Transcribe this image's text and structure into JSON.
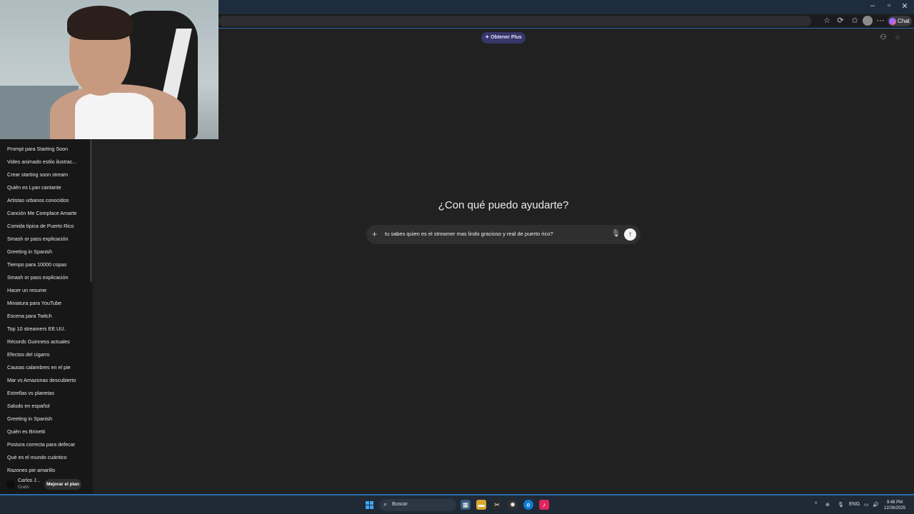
{
  "browser": {
    "chat_label": "Chat",
    "window_controls": [
      "–",
      "▫",
      "✕"
    ]
  },
  "header": {
    "plus_label": "Obtener Plus"
  },
  "sidebar": {
    "items": [
      "Prompt para Starting Soon",
      "Video animado estilo ilustrac...",
      "Crear starting soon stream",
      "Quién es Lyan cantante",
      "Artistas urbanos conocidos",
      "Canción Me Complace Amarte",
      "Comida típica de Puerto Rico",
      "Smash or pass explicación",
      "Greeting in Spanish",
      "Tiempo para 10000 copas",
      "Smash or pass explicación",
      "Hacer un resume",
      "Miniatura para YouTube",
      "Escena para Twitch",
      "Top 10 streamers EE.UU.",
      "Récords Guinness actuales",
      "Efectos del cigarro",
      "Causas calambres en el pie",
      "Mar vs Amazonas descubierto",
      "Estrellas vs planetas",
      "Saludo en español",
      "Greeting in Spanish",
      "Quién es Brinetti",
      "Postura correcta para defecar",
      "Qué es el mundo cuántico",
      "Razones pie amarillo"
    ],
    "user": {
      "name": "Carlos J...",
      "plan": "Gratis",
      "upgrade_label": "Mejorar el plan"
    }
  },
  "main": {
    "hero_title": "¿Con qué puedo ayudarte?",
    "composer_text": "tu sabes quien es el streamer mas lindo gracioso y real de puerto rico?"
  },
  "taskbar": {
    "search_label": "Buscar",
    "language": "ENG",
    "time": "9:48 PM",
    "date": "12/26/2025"
  },
  "icons": {
    "colors": {
      "accent_blue": "#2b6cb0",
      "plus_pill": "#373669"
    }
  }
}
